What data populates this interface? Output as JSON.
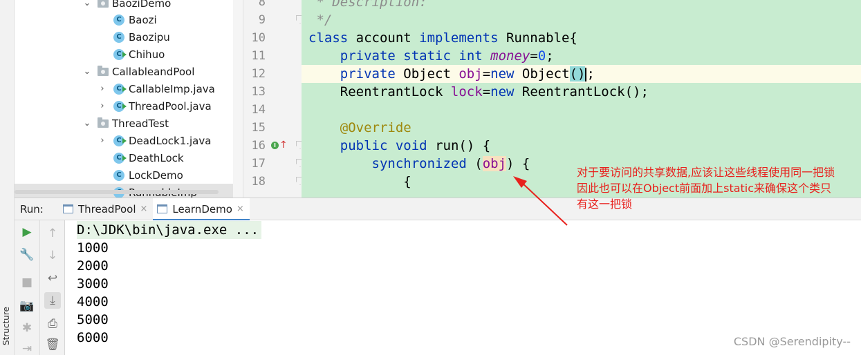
{
  "side_strip": {
    "structure_label": "Structure"
  },
  "project_tree": {
    "items": [
      {
        "label": "BaoziDemo",
        "kind": "folder",
        "expanded": true
      },
      {
        "label": "Baozi",
        "kind": "class"
      },
      {
        "label": "Baozipu",
        "kind": "class"
      },
      {
        "label": "Chihuo",
        "kind": "runnable-class"
      },
      {
        "label": "CallableandPool",
        "kind": "folder",
        "expanded": true
      },
      {
        "label": "CallableImp.java",
        "kind": "runnable-class",
        "collapsed": true
      },
      {
        "label": "ThreadPool.java",
        "kind": "runnable-class",
        "collapsed": true
      },
      {
        "label": "ThreadTest",
        "kind": "folder",
        "expanded": true
      },
      {
        "label": "DeadLock1.java",
        "kind": "runnable-class",
        "collapsed": true
      },
      {
        "label": "DeathLock",
        "kind": "runnable-class"
      },
      {
        "label": "LockDemo",
        "kind": "class"
      },
      {
        "label": "RunnableImp",
        "kind": "class",
        "selected": true
      }
    ],
    "class_icon_letter": "C",
    "chevron_open": "⌄",
    "chevron_closed": "›"
  },
  "editor": {
    "line_numbers": [
      "8",
      "9",
      "10",
      "11",
      "12",
      "13",
      "14",
      "15",
      "16",
      "17",
      "18"
    ],
    "code": {
      "l8_doc": " * Description:",
      "l9_doc": " */",
      "l10_kw1": "class",
      "l10_name": " account ",
      "l10_kw2": "implements",
      "l10_rest": " Runnable{",
      "l11_indent": "    ",
      "l11_kw1": "private",
      "l11_sp1": " ",
      "l11_kw2": "static",
      "l11_sp2": " ",
      "l11_kw3": "int",
      "l11_sp3": " ",
      "l11_field": "money",
      "l11_eq": "=",
      "l11_num": "0",
      "l11_end": ";",
      "l12_indent": "    ",
      "l12_kw1": "private",
      "l12_type": " Object ",
      "l12_field": "obj",
      "l12_eq": "=",
      "l12_kw2": "new",
      "l12_call": " Object",
      "l12_paren": "()",
      "l12_end": ";",
      "l13_indent": "    ",
      "l13_type": "ReentrantLock ",
      "l13_field": "lock",
      "l13_eq": "=",
      "l13_kw": "new",
      "l13_rest": " ReentrantLock();",
      "l15_indent": "    ",
      "l15_ann": "@Override",
      "l16_indent": "    ",
      "l16_kw1": "public",
      "l16_sp": " ",
      "l16_kw2": "void",
      "l16_rest": " run() {",
      "l17_indent": "        ",
      "l17_kw": "synchronized",
      "l17_open": " (",
      "l17_field": "obj",
      "l17_close": ") {",
      "l18_text": "            {"
    },
    "override_marker_letter": "I",
    "override_marker_arrow": "↑"
  },
  "annotation": {
    "lines": [
      "对于要访问的共享数据,应该让这些线程使用同一把锁",
      "因此也可以在Object前面加上static来确保这个类只",
      "有这一把锁"
    ],
    "color": "#e8211d"
  },
  "run_panel": {
    "label": "Run:",
    "tabs": [
      {
        "label": "ThreadPool",
        "active": false
      },
      {
        "label": "LearnDemo",
        "active": true
      }
    ],
    "close_glyph": "×",
    "toolbar_1": {
      "run_icon": "▶",
      "settings_icon": "🔧",
      "stop_icon": "■",
      "camera_icon": "📷",
      "debug_icon": "✱",
      "exit_icon": "⇥"
    },
    "toolbar_2": {
      "up_icon": "↑",
      "down_icon": "↓",
      "wrap_icon": "↩",
      "scroll_end_icon": "⤓",
      "print_icon": "⎙",
      "trash_icon": "🗑"
    },
    "console_lines": [
      "D:\\JDK\\bin\\java.exe ...",
      "1000",
      "2000",
      "3000",
      "4000",
      "5000",
      "6000"
    ]
  },
  "watermark": "CSDN @Serendipity--"
}
